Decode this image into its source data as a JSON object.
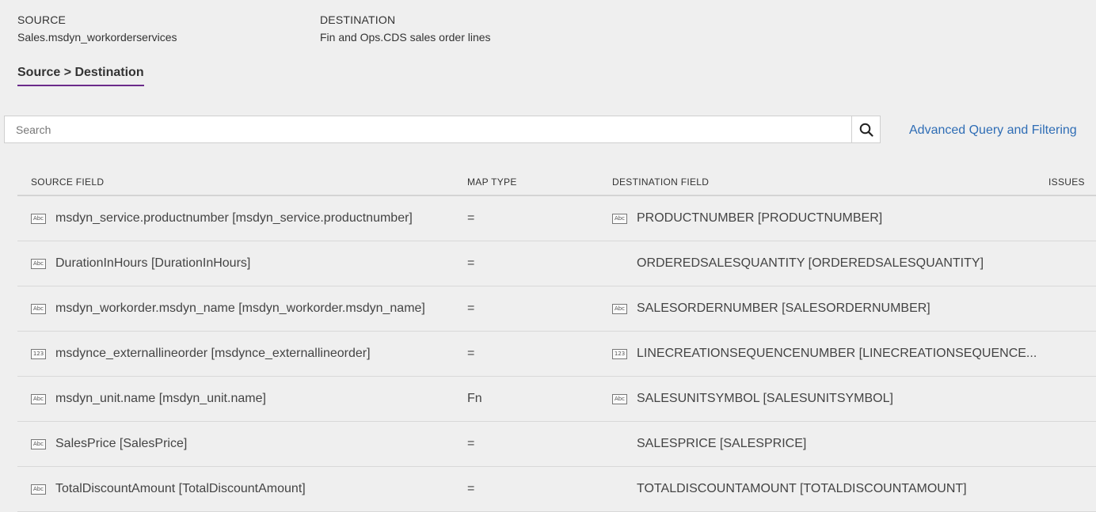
{
  "header": {
    "source_label": "SOURCE",
    "source_value": "Sales.msdyn_workorderservices",
    "destination_label": "DESTINATION",
    "destination_value": "Fin and Ops.CDS sales order lines"
  },
  "tab": {
    "label": "Source > Destination"
  },
  "search": {
    "placeholder": "Search",
    "value": "",
    "icon": "search-icon"
  },
  "advanced_link": "Advanced Query and Filtering",
  "colors": {
    "accent": "#6b2a8a",
    "link": "#2f6db5"
  },
  "table": {
    "columns": [
      "SOURCE FIELD",
      "MAP TYPE",
      "DESTINATION FIELD",
      "ISSUES"
    ],
    "rows": [
      {
        "src_icon": "Abc",
        "source": "msdyn_service.productnumber [msdyn_service.productnumber]",
        "map": "=",
        "dst_icon": "Abc",
        "destination": "PRODUCTNUMBER [PRODUCTNUMBER]"
      },
      {
        "src_icon": "Abc",
        "source": "DurationInHours [DurationInHours]",
        "map": "=",
        "dst_icon": "",
        "destination": "ORDEREDSALESQUANTITY [ORDEREDSALESQUANTITY]"
      },
      {
        "src_icon": "Abc",
        "source": "msdyn_workorder.msdyn_name [msdyn_workorder.msdyn_name]",
        "map": "=",
        "dst_icon": "Abc",
        "destination": "SALESORDERNUMBER [SALESORDERNUMBER]"
      },
      {
        "src_icon": "123",
        "source": "msdynce_externallineorder [msdynce_externallineorder]",
        "map": "=",
        "dst_icon": "123",
        "destination": "LINECREATIONSEQUENCENUMBER [LINECREATIONSEQUENCE..."
      },
      {
        "src_icon": "Abc",
        "source": "msdyn_unit.name [msdyn_unit.name]",
        "map": "Fn",
        "dst_icon": "Abc",
        "destination": "SALESUNITSYMBOL [SALESUNITSYMBOL]"
      },
      {
        "src_icon": "Abc",
        "source": "SalesPrice [SalesPrice]",
        "map": "=",
        "dst_icon": "",
        "destination": "SALESPRICE [SALESPRICE]"
      },
      {
        "src_icon": "Abc",
        "source": "TotalDiscountAmount [TotalDiscountAmount]",
        "map": "=",
        "dst_icon": "",
        "destination": "TOTALDISCOUNTAMOUNT [TOTALDISCOUNTAMOUNT]"
      }
    ]
  }
}
